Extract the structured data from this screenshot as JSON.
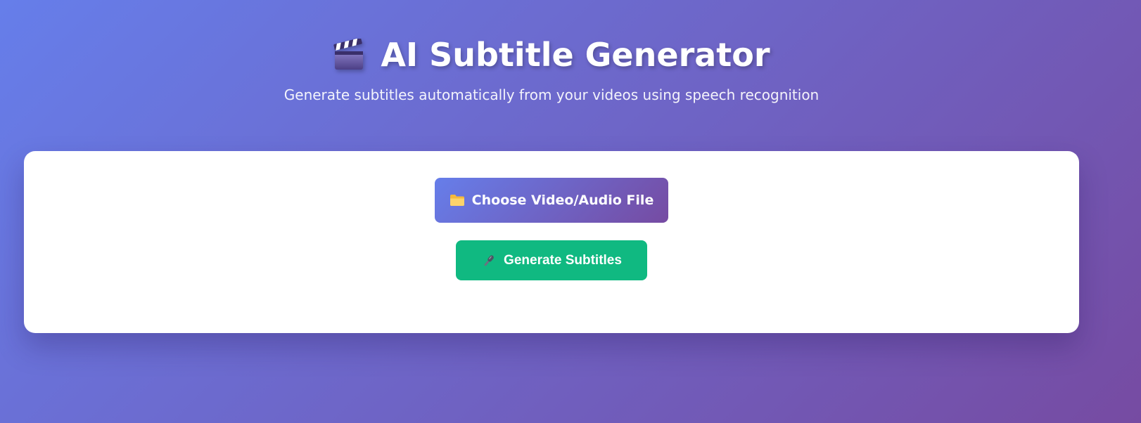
{
  "header": {
    "title": "AI Subtitle Generator",
    "title_icon": "clapperboard-icon",
    "subtitle": "Generate subtitles automatically from your videos using speech recognition"
  },
  "actions": {
    "choose_file": {
      "label": "Choose Video/Audio File",
      "icon": "folder-icon"
    },
    "generate": {
      "label": "Generate Subtitles",
      "icon": "microphone-icon"
    }
  },
  "colors": {
    "gradient_start": "#667eea",
    "gradient_end": "#764ba2",
    "generate_button": "#10b981",
    "card_background": "#ffffff"
  }
}
